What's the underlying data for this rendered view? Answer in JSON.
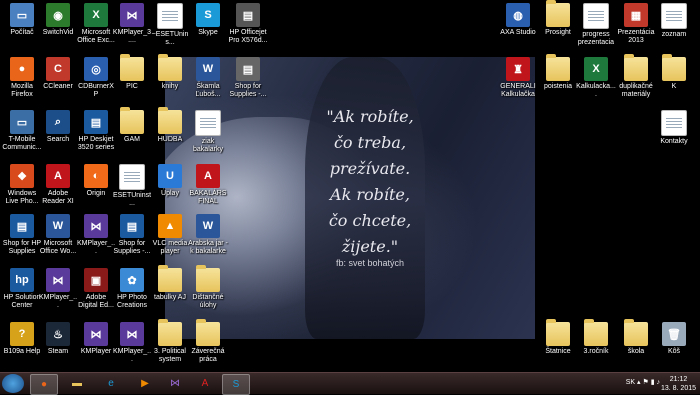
{
  "wallpaper": {
    "quote": "\"Ak robíte,\nčo treba,\nprežívate.\nAk robíte,\nčo chcete,\nžijete.\"",
    "credit": "fb:  svet bohatých"
  },
  "icons_left": [
    {
      "label": "Počítač",
      "icon": "computer-icon",
      "color": "#4a7fc0",
      "glyph": "▭"
    },
    {
      "label": "SwitchVid",
      "icon": "switchvid-icon",
      "color": "#2c7a2c",
      "glyph": "◉"
    },
    {
      "label": "Microsoft Office Exc...",
      "icon": "excel-icon",
      "color": "#1e7a3c",
      "glyph": "X"
    },
    {
      "label": "KMPlayer_3....",
      "icon": "kmplayer-icon",
      "color": "#5a3a9a",
      "glyph": "⋈"
    },
    {
      "label": "~ESETUnins...",
      "icon": "document-icon",
      "color": "",
      "glyph": ""
    },
    {
      "label": "Skype",
      "icon": "skype-icon",
      "color": "#1a9ad6",
      "glyph": "S"
    },
    {
      "label": "HP Officejet Pro X576d...",
      "icon": "printer-icon",
      "color": "#555",
      "glyph": "▤"
    },
    {
      "label": "Mozilla Firefox",
      "icon": "firefox-icon",
      "color": "#e8651a",
      "glyph": "●"
    },
    {
      "label": "CCleaner",
      "icon": "ccleaner-icon",
      "color": "#c0392b",
      "glyph": "C"
    },
    {
      "label": "CDBurnerXP",
      "icon": "cdburner-icon",
      "color": "#2a5fb0",
      "glyph": "◎"
    },
    {
      "label": "PIC",
      "icon": "folder-icon",
      "color": "",
      "glyph": ""
    },
    {
      "label": "knihy",
      "icon": "folder-icon",
      "color": "",
      "glyph": ""
    },
    {
      "label": "Škamla Ľuboš...",
      "icon": "word-icon",
      "color": "#2b579a",
      "glyph": "W"
    },
    {
      "label": "Shop for Supplies -...",
      "icon": "printer-icon",
      "color": "#666",
      "glyph": "▤"
    },
    {
      "label": "T-Mobile Communic...",
      "icon": "tmobile-icon",
      "color": "#3a6ea5",
      "glyph": "▭"
    },
    {
      "label": "Search",
      "icon": "search-icon",
      "color": "#1c4f8a",
      "glyph": "⌕"
    },
    {
      "label": "HP Deskjet 3520 series",
      "icon": "printer-icon",
      "color": "#1c5aa0",
      "glyph": "▤"
    },
    {
      "label": "GAM",
      "icon": "folder-icon",
      "color": "",
      "glyph": ""
    },
    {
      "label": "HUDBA",
      "icon": "folder-icon",
      "color": "",
      "glyph": ""
    },
    {
      "label": "ziak bakalarky",
      "icon": "document-icon",
      "color": "",
      "glyph": ""
    },
    {
      "label": "Windows Live Pho...",
      "icon": "windows-live-icon",
      "color": "#d84a1b",
      "glyph": "❖"
    },
    {
      "label": "Adobe Reader XI",
      "icon": "pdf-icon",
      "color": "#c0151b",
      "glyph": "A"
    },
    {
      "label": "Origin",
      "icon": "origin-icon",
      "color": "#f06a1a",
      "glyph": "◐"
    },
    {
      "label": "ESETUninst...",
      "icon": "document-icon",
      "color": "",
      "glyph": ""
    },
    {
      "label": "Úplay",
      "icon": "uplay-icon",
      "color": "#2a7ad6",
      "glyph": "U"
    },
    {
      "label": "BAKALÁRS FINAL",
      "icon": "pdf-icon",
      "color": "#c0151b",
      "glyph": "A"
    },
    {
      "label": "Shop for HP Supplies",
      "icon": "printer-icon",
      "color": "#1c5aa0",
      "glyph": "▤"
    },
    {
      "label": "Microsoft Office Wo...",
      "icon": "word-icon",
      "color": "#2b579a",
      "glyph": "W"
    },
    {
      "label": "KMPlayer_...",
      "icon": "kmplayer-icon",
      "color": "#5a3a9a",
      "glyph": "⋈"
    },
    {
      "label": "Shop for Supplies -...",
      "icon": "printer-icon",
      "color": "#1c5aa0",
      "glyph": "▤"
    },
    {
      "label": "VLC media player",
      "icon": "vlc-icon",
      "color": "#f08a00",
      "glyph": "▲"
    },
    {
      "label": "Arabska jar - k bakalarke",
      "icon": "word-icon",
      "color": "#2b579a",
      "glyph": "W"
    },
    {
      "label": "HP Solution Center",
      "icon": "hp-icon",
      "color": "#1c5aa0",
      "glyph": "hp"
    },
    {
      "label": "KMPlayer_...",
      "icon": "kmplayer-icon",
      "color": "#5a3a9a",
      "glyph": "⋈"
    },
    {
      "label": "Adobe Digital Ed...",
      "icon": "adobe-de-icon",
      "color": "#8a1a1a",
      "glyph": "▣"
    },
    {
      "label": "HP Photo Creations",
      "icon": "hp-photo-icon",
      "color": "#3a8ad6",
      "glyph": "✿"
    },
    {
      "label": "tabulky AJ",
      "icon": "folder-icon",
      "color": "",
      "glyph": ""
    },
    {
      "label": "Dištančné úlohy",
      "icon": "folder-icon",
      "color": "",
      "glyph": ""
    },
    {
      "label": "B109a Help",
      "icon": "help-icon",
      "color": "#d6a21a",
      "glyph": "?"
    },
    {
      "label": "Steam",
      "icon": "steam-icon",
      "color": "#1b2838",
      "glyph": "♨"
    },
    {
      "label": "KMPlayer",
      "icon": "kmplayer-icon",
      "color": "#5a3a9a",
      "glyph": "⋈"
    },
    {
      "label": "KMPlayer_...",
      "icon": "kmplayer-icon",
      "color": "#5a3a9a",
      "glyph": "⋈"
    },
    {
      "label": "3. Political system",
      "icon": "folder-icon",
      "color": "",
      "glyph": ""
    },
    {
      "label": "Záverečná práca",
      "icon": "folder-icon",
      "color": "",
      "glyph": ""
    }
  ],
  "icons_right": [
    {
      "label": "AXA Studio",
      "icon": "globe-icon",
      "color": "#2a5fb0",
      "glyph": "◍"
    },
    {
      "label": "Prosight",
      "icon": "folder-icon",
      "color": "",
      "glyph": ""
    },
    {
      "label": "progress prezentacia",
      "icon": "document-icon",
      "color": "",
      "glyph": ""
    },
    {
      "label": "Prezentácia 2013",
      "icon": "presentation-icon",
      "color": "#c0392b",
      "glyph": "▦"
    },
    {
      "label": "zoznam",
      "icon": "document-icon",
      "color": "",
      "glyph": ""
    },
    {
      "label": "GENERALI Kalkulačka",
      "icon": "generali-icon",
      "color": "#c0151b",
      "glyph": "♜"
    },
    {
      "label": "poistenia",
      "icon": "folder-icon",
      "color": "",
      "glyph": ""
    },
    {
      "label": "Kalkulacka....",
      "icon": "excel-icon",
      "color": "#1e7a3c",
      "glyph": "X"
    },
    {
      "label": "duplikačné materiály",
      "icon": "folder-icon",
      "color": "",
      "glyph": ""
    },
    {
      "label": "K",
      "icon": "folder-icon",
      "color": "",
      "glyph": ""
    },
    {
      "label": "Kontakty",
      "icon": "document-icon",
      "color": "",
      "glyph": ""
    },
    {
      "label": "Štatnice",
      "icon": "folder-icon",
      "color": "",
      "glyph": ""
    },
    {
      "label": "3.ročník",
      "icon": "folder-icon",
      "color": "",
      "glyph": ""
    },
    {
      "label": "škola",
      "icon": "folder-icon",
      "color": "",
      "glyph": ""
    },
    {
      "label": "Kôš",
      "icon": "recycle-bin-icon",
      "color": "#9ab",
      "glyph": "🗑"
    }
  ],
  "taskbar": {
    "apps": [
      {
        "name": "firefox-taskbar-icon",
        "glyph": "●",
        "color": "#e8651a",
        "active": true
      },
      {
        "name": "explorer-taskbar-icon",
        "glyph": "▬",
        "color": "#e7c45c",
        "active": false
      },
      {
        "name": "ie-taskbar-icon",
        "glyph": "e",
        "color": "#1a9ad6",
        "active": false
      },
      {
        "name": "media-player-taskbar-icon",
        "glyph": "▶",
        "color": "#f08a00",
        "active": false
      },
      {
        "name": "kmplayer-taskbar-icon",
        "glyph": "⋈",
        "color": "#9a6ad6",
        "active": false
      },
      {
        "name": "pdf-taskbar-icon",
        "glyph": "A",
        "color": "#e02020",
        "active": false
      },
      {
        "name": "skype-taskbar-icon",
        "glyph": "S",
        "color": "#1a9ad6",
        "active": true
      }
    ],
    "language": "SK",
    "time": "21:12",
    "date": "13. 8. 2015"
  }
}
